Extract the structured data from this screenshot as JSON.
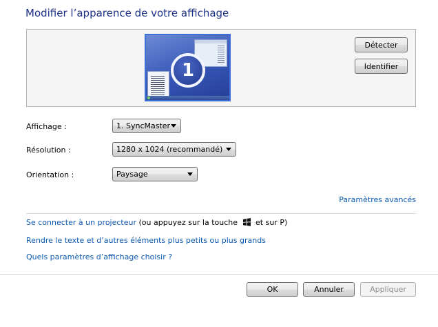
{
  "page": {
    "title": "Modifier l’apparence de votre affichage"
  },
  "preview": {
    "monitor_number": "1",
    "detect_label": "Détecter",
    "identify_label": "Identifier"
  },
  "settings": {
    "display": {
      "label": "Affichage :",
      "value": "1. SyncMaster"
    },
    "resolution": {
      "label": "Résolution :",
      "value": "1280 x 1024 (recommandé)"
    },
    "orientation": {
      "label": "Orientation :",
      "value": "Paysage"
    }
  },
  "links": {
    "advanced": "Paramètres avancés",
    "projector": "Se connecter à un projecteur",
    "projector_hint_before": " (ou appuyez sur la touche ",
    "projector_hint_after": " et sur P)",
    "text_size": "Rendre le texte et d’autres éléments plus petits ou plus grands",
    "which_settings": "Quels paramètres d’affichage choisir ?"
  },
  "footer": {
    "ok_label": "OK",
    "cancel_label": "Annuler",
    "apply_label": "Appliquer"
  },
  "colors": {
    "title": "#1e3287",
    "link": "#0b57b0",
    "accent": "#3d6fd6"
  }
}
